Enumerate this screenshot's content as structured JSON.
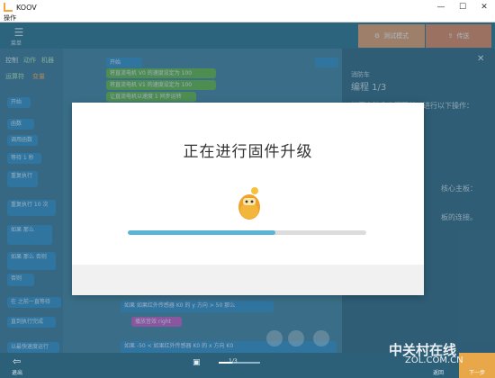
{
  "window": {
    "app_title": "KOOV",
    "menu_label": "操作",
    "minimize": "—",
    "maximize": "☐",
    "close": "✕"
  },
  "toolbar": {
    "menu_icon": "☰",
    "menu_label": "菜单",
    "test_mode": "测试模式",
    "send": "传送"
  },
  "palette": {
    "tabs": [
      "控制",
      "动作",
      "机器"
    ],
    "tabs2": [
      "运算符",
      "变量"
    ],
    "blocks": [
      "开始",
      "函数",
      "调用函数",
      "等待 1 秒",
      "重复执行",
      "重复执行 10 次",
      "如果 那么",
      "如果 那么 否则",
      "否则",
      "在 之前一直等待",
      "直到执行完成",
      "以最快速度运行"
    ]
  },
  "workspace": {
    "blocks": [
      "开始",
      "将直流电机 V0 的速度设定为 100",
      "将直流电机 V1 的速度设定为 100",
      "让直流电机以速度 1 同步运转",
      "如果 如果红外传感器 K0 的 y 方向 > 50 那么",
      "播放音效 right",
      "如果 -50 < 如果红外传感器 K0 的 x 方向 K0"
    ]
  },
  "right_panel": {
    "close_icon": "✕",
    "small_title": "消防车",
    "title": "编程 1/3",
    "line1": "打开电池盒电源开关，进行以下操作：",
    "line2": "核心主板：",
    "line3": "板的连接。"
  },
  "modal": {
    "title": "正在进行固件升级",
    "progress": 0.62
  },
  "bottom": {
    "back_icon": "⇦",
    "back_label": "退出",
    "page": "1/3",
    "prev_label": "返回",
    "next_label": "下一步"
  },
  "watermark": {
    "main": "中关村在线",
    "sub": "ZOL.COM.CN"
  }
}
